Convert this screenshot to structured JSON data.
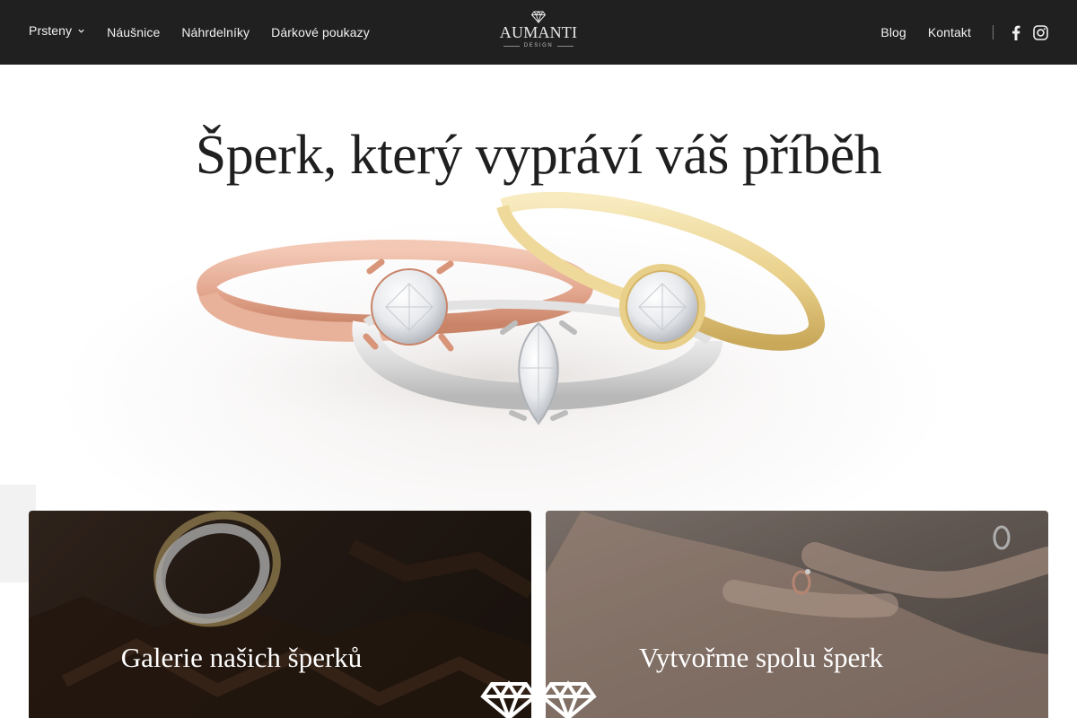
{
  "nav": {
    "left_links": [
      {
        "label": "Prsteny",
        "has_dropdown": true
      },
      {
        "label": "Náušnice"
      },
      {
        "label": "Náhrdelníky"
      },
      {
        "label": "Dárkové poukazy"
      }
    ],
    "logo": {
      "word": "AUMANTI",
      "sub": "DESIGN"
    },
    "right_links": [
      {
        "label": "Blog"
      },
      {
        "label": "Kontakt"
      }
    ],
    "social_icons": [
      "facebook-icon",
      "instagram-icon"
    ]
  },
  "hero": {
    "title": "Šperk, který vypráví váš příběh"
  },
  "cards": [
    {
      "title": "Galerie našich šperků"
    },
    {
      "title": "Vytvořme spolu šperk"
    }
  ],
  "colors": {
    "nav_bg": "#202020",
    "nav_text": "#f1f1f1",
    "rose_gold": "#e3a78f",
    "yellow_gold": "#e9d08a",
    "white_gold": "#d9d9d9"
  }
}
